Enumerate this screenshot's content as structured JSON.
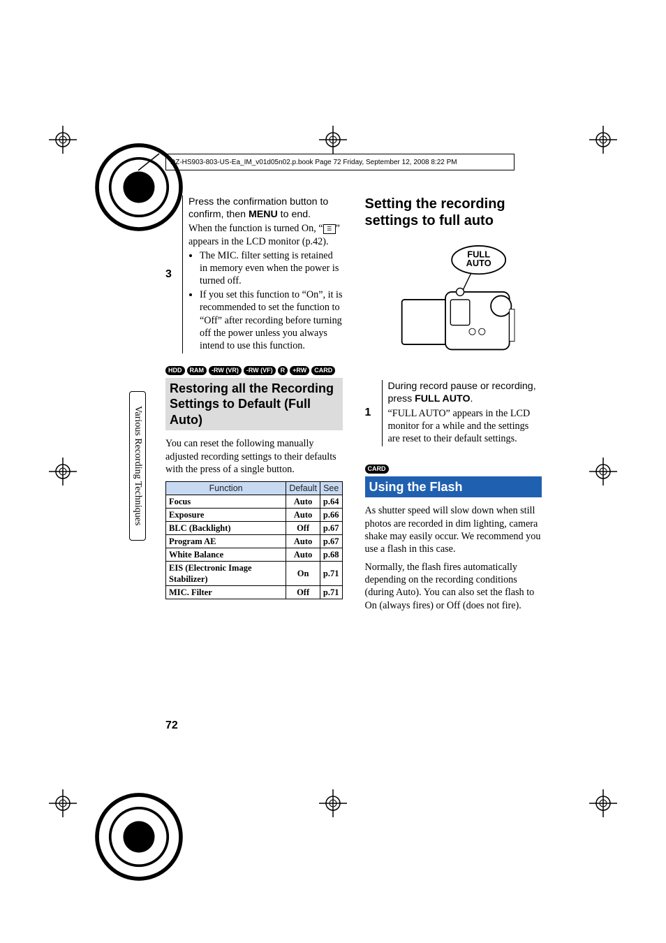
{
  "page_header": "DZ-HS903-803-US-Ea_IM_v01d05n02.p.book  Page 72  Friday, September 12, 2008  8:22 PM",
  "side_tab": "Various Recording Techniques",
  "page_number": "72",
  "left": {
    "step_num": "3",
    "step_lead_1": "Press the confirmation button to confirm, then ",
    "step_lead_menu": "MENU",
    "step_lead_2": " to end.",
    "on_text_1": "When the function is turned On, “",
    "on_icon_name": "mic-filter-icon",
    "on_text_2": "” appears in the LCD monitor (p.42).",
    "bullet1": "The MIC. filter setting is retained in memory even when the power is turned off.",
    "bullet2": "If you set this function to “On”, it is recommended to set the function to “Off” after recording before turning off the power unless you always intend to use this function.",
    "badges": [
      "HDD",
      "RAM",
      "-RW (VR)",
      "-RW (VF)",
      "R",
      "+RW",
      "CARD"
    ],
    "title": "Restoring all the Recording Settings to Default (Full Auto)",
    "intro": "You can reset the following manually adjusted recording settings to their defaults with the press of a single button.",
    "table": {
      "headers": {
        "func": "Function",
        "def": "Default",
        "see": "See"
      },
      "rows": [
        {
          "func": "Focus",
          "def": "Auto",
          "see": "p.64"
        },
        {
          "func": "Exposure",
          "def": "Auto",
          "see": "p.66"
        },
        {
          "func": "BLC (Backlight)",
          "def": "Off",
          "see": "p.67"
        },
        {
          "func": "Program AE",
          "def": "Auto",
          "see": "p.67"
        },
        {
          "func": "White Balance",
          "def": "Auto",
          "see": "p.68"
        },
        {
          "func": "EIS (Electronic Image Stabilizer)",
          "def": "On",
          "see": "p.71"
        },
        {
          "func": "MIC. Filter",
          "def": "Off",
          "see": "p.71"
        }
      ]
    }
  },
  "right": {
    "title1": "Setting the recording settings to full auto",
    "illus_label": "FULL\nAUTO",
    "step_num": "1",
    "step_lead_1": "During record pause or recording, press ",
    "step_lead_bold": "FULL AUTO",
    "step_lead_2": ".",
    "step_body": "“FULL AUTO” appears in the LCD monitor for a while and the settings are reset to their default settings.",
    "badge_card": "CARD",
    "title2": "Using the Flash",
    "flash_p1": "As shutter speed will slow down when still photos are recorded in dim lighting, camera shake may easily occur. We recommend you use a flash in this case.",
    "flash_p2": "Normally, the flash fires automatically depending on the recording conditions (during Auto). You can also set the flash to On (always fires) or Off (does not fire)."
  }
}
